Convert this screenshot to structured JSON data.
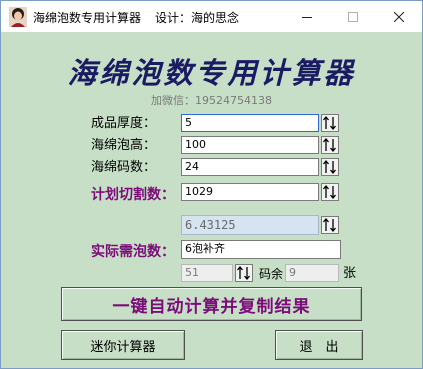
{
  "window": {
    "title": "海绵泡数专用计算器",
    "designer": "设计：海的思念"
  },
  "header": {
    "app_title": "海绵泡数专用计算器",
    "wechat": "加微信：19524754138"
  },
  "form": {
    "thickness_label": "成品厚度：",
    "thickness_value": "5",
    "height_label": "海绵泡高：",
    "height_value": "100",
    "stack_label": "海绵码数：",
    "stack_value": "24",
    "plan_label": "计划切割数：",
    "plan_value": "1029",
    "result_value": "6.43125",
    "need_label": "实际需泡数：",
    "need_value": "6泡补齐",
    "count_value": "51",
    "remainder_label": "码余",
    "remainder_value": "9",
    "sheets_unit": "张"
  },
  "buttons": {
    "auto_calc": "一键自动计算并复制结果",
    "mini_calc": "迷你计算器",
    "exit": "退　出"
  },
  "colors": {
    "background": "#c6dfc6",
    "title_navy": "#1b1b63",
    "purple_accent": "#7b0c79"
  }
}
